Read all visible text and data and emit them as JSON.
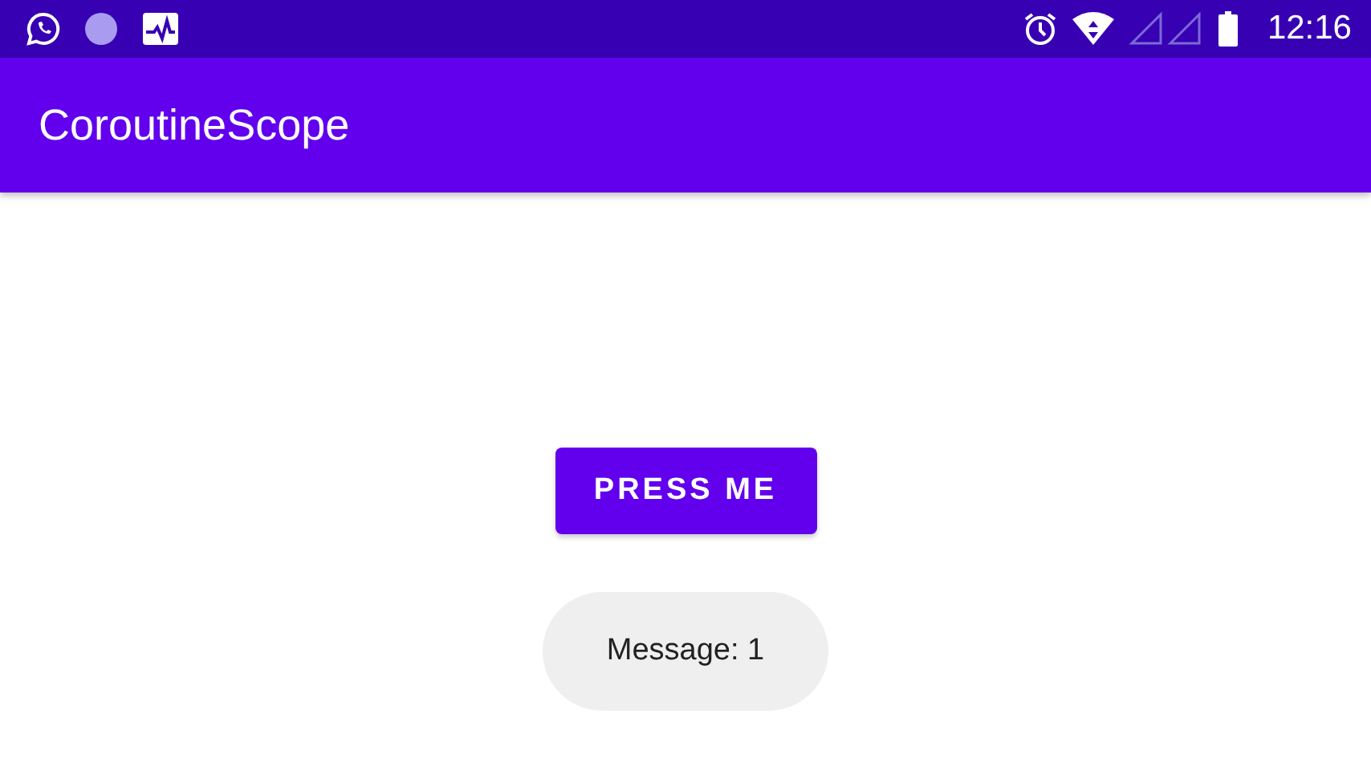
{
  "status_bar": {
    "time": "12:16"
  },
  "app_bar": {
    "title": "CoroutineScope"
  },
  "button": {
    "label": "PRESS ME"
  },
  "toast": {
    "text": "Message: 1"
  }
}
